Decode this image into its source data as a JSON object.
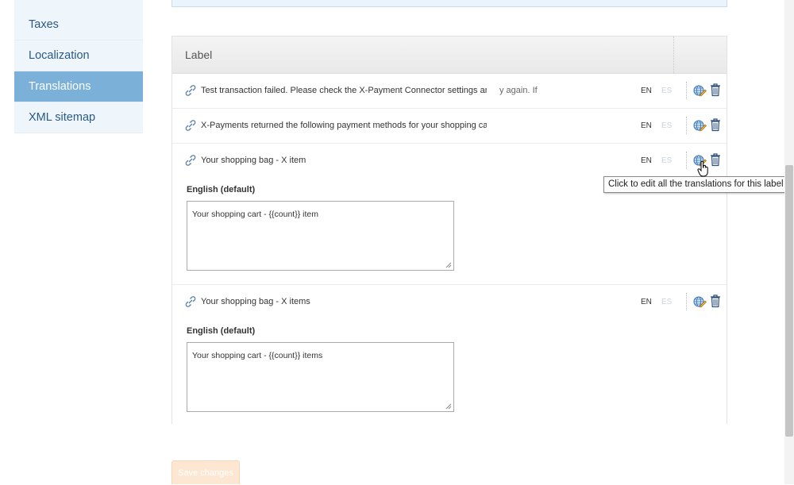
{
  "sidebar": {
    "items": [
      {
        "label": "Taxes",
        "active": false
      },
      {
        "label": "Localization",
        "active": false
      },
      {
        "label": "Translations",
        "active": true
      },
      {
        "label": "XML sitemap",
        "active": false
      }
    ]
  },
  "table": {
    "header": "Label",
    "rows": [
      {
        "label": "Test transaction failed. Please check the X-Payment Connector settings an",
        "label_tail": "y again. If",
        "lang_en": "EN",
        "lang_es": "ES"
      },
      {
        "label": "X-Payments returned the following payment methods for your shopping ca",
        "lang_en": "EN",
        "lang_es": "ES"
      },
      {
        "label": "Your shopping bag - X item",
        "lang_en": "EN",
        "lang_es": "ES",
        "field_label": "English (default)",
        "field_value": "Your shopping cart - {{count}} item"
      },
      {
        "label": "Your shopping bag - X items",
        "lang_en": "EN",
        "lang_es": "ES",
        "field_label": "English (default)",
        "field_value": "Your shopping cart - {{count}} items"
      }
    ]
  },
  "tooltip": "Click to edit all the translations for this label",
  "actions": {
    "save_label": "Save changes"
  },
  "icons": {
    "label": "label-link-icon",
    "edit": "globe-pencil-icon",
    "delete": "trash-icon"
  },
  "colors": {
    "sidebar_active": "#7bb0d8",
    "sidebar_bg": "#eef5fb",
    "link_text": "#2a5a86",
    "save_button": "#fde7d2"
  }
}
